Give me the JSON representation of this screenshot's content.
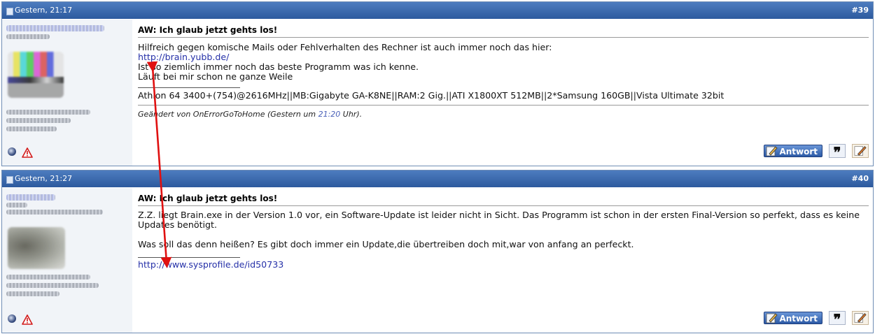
{
  "posts": [
    {
      "date": "Gestern, 21:17",
      "number": "#39",
      "title": "AW: Ich glaub jetzt gehts los!",
      "lines": [
        "Hilfreich gegen komische Mails oder Fehlverhalten des Rechner ist auch immer noch das hier:",
        "Ist so ziemlich immer noch das beste Programm was ich kenne.",
        "Läuft bei mir schon ne ganze Weile"
      ],
      "link": "http://brain.yubb.de/",
      "signature": "Athlon 64 3400+(754)@2616MHz||MB:Gigabyte GA-K8NE||RAM:2 Gig.||ATI X1800XT 512MB||2*Samsung 160GB||Vista Ultimate 32bit",
      "edit_prefix": "Geändert von OnErrorGoToHome (Gestern um ",
      "edit_time": "21:20",
      "edit_suffix": " Uhr).",
      "answer_label": "Antwort"
    },
    {
      "date": "Gestern, 21:27",
      "number": "#40",
      "title": "AW: Ich glaub jetzt gehts los!",
      "paragraph1": "Z.Z. liegt Brain.exe in der Version 1.0 vor, ein Software-Update ist leider nicht in Sicht. Das Programm ist schon in der ersten Final-Version so perfekt, dass es keine Updates benötigt.",
      "paragraph2": "Was soll das denn heißen? Es gibt doch immer ein Update,die übertreiben doch mit,war von anfang an perfeckt.",
      "signature_link": "http://www.sysprofile.de/id50733",
      "answer_label": "Antwort"
    }
  ],
  "icons": [
    "document-icon",
    "online-status-icon",
    "report-warning-icon",
    "pen-icon",
    "quote-icon",
    "edit-icon"
  ],
  "colors": {
    "header": "#3b68ad",
    "link": "#2530a8",
    "arrow": "#e01010",
    "user_column": "#f1f4f8"
  }
}
